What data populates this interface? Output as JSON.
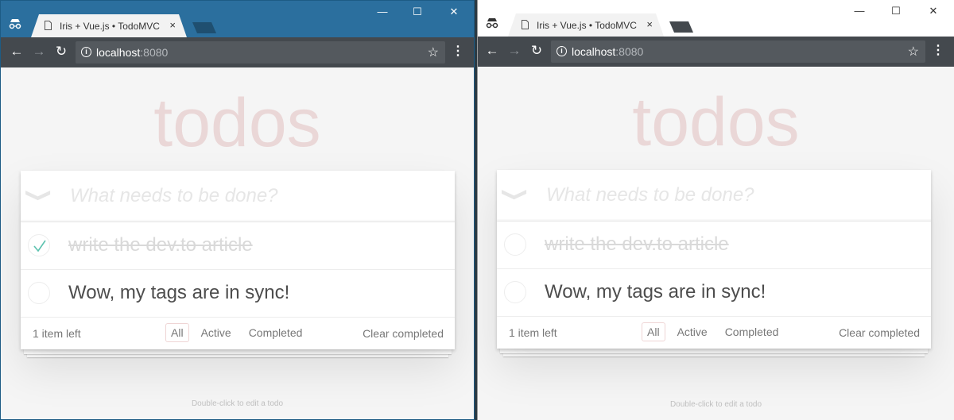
{
  "windows": [
    {
      "tab": {
        "title": "Iris + Vue.js • TodoMVC",
        "close": "×"
      },
      "controls": {
        "minimize": "—",
        "maximize": "☐",
        "close": "✕"
      },
      "omnibox": {
        "host": "localhost",
        "port": ":8080"
      },
      "app": {
        "heading": "todos",
        "new_placeholder": "What needs to be done?",
        "toggle_all": "❯",
        "items": [
          {
            "label": "write the dev.to article",
            "completed": true
          },
          {
            "label": "Wow, my tags are in sync!",
            "completed": false
          }
        ],
        "footer": {
          "count": "1 item left",
          "filters": [
            "All",
            "Active",
            "Completed"
          ],
          "selected": "All",
          "clear": "Clear completed"
        },
        "info": "Double-click to edit a todo"
      }
    },
    {
      "tab": {
        "title": "Iris + Vue.js • TodoMVC",
        "close": "×"
      },
      "controls": {
        "minimize": "—",
        "maximize": "☐",
        "close": "✕"
      },
      "omnibox": {
        "host": "localhost",
        "port": ":8080"
      },
      "app": {
        "heading": "todos",
        "new_placeholder": "What needs to be done?",
        "toggle_all": "❯",
        "items": [
          {
            "label": "write the dev.to article",
            "completed": false
          },
          {
            "label": "Wow, my tags are in sync!",
            "completed": false
          }
        ],
        "footer": {
          "count": "1 item left",
          "filters": [
            "All",
            "Active",
            "Completed"
          ],
          "selected": "All",
          "clear": "Clear completed"
        },
        "info": "Double-click to edit a todo"
      }
    }
  ],
  "colors": {
    "active_titlebar": "#2b6f9e",
    "toolbar": "#44494e",
    "heading": "#af2f2f",
    "check_green": "#5dc2af"
  }
}
